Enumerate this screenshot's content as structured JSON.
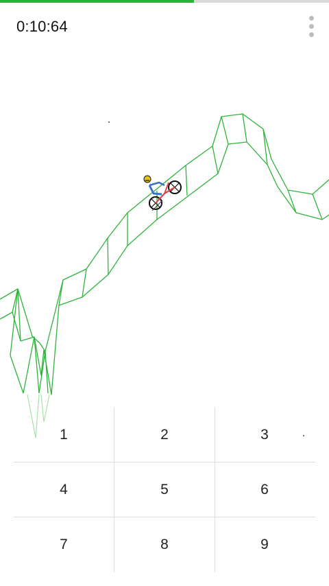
{
  "status": {
    "timer": "0:10:64",
    "progress_fraction": 0.59
  },
  "menu": {
    "icon": "more-vert-icon"
  },
  "game": {
    "track_color": "#2db33a",
    "rider": "motorbike-rider"
  },
  "keypad": {
    "keys": [
      "1",
      "2",
      "3",
      "4",
      "5",
      "6",
      "7",
      "8",
      "9"
    ]
  },
  "colors": {
    "progress_fill": "#2db33a",
    "progress_track": "#d9d9d9",
    "divider": "#dcdcdc"
  }
}
